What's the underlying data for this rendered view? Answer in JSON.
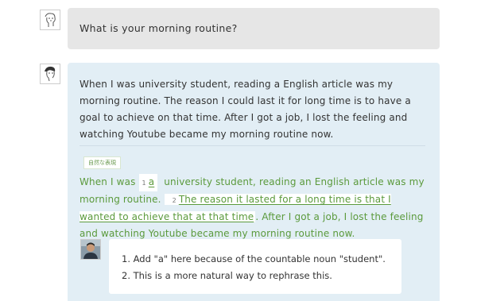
{
  "question": {
    "text": "What is your morning routine?"
  },
  "answer": {
    "text": "When I was university student, reading a English article was my morning routine. The reason I could last it for long time is to have a goal to achieve on that time. After I got a job, I lost the feeling and watching Youtube became my morning routine now."
  },
  "correction": {
    "tag": "自然な表現",
    "part1": "When I was",
    "num1": "1",
    "insert1": "a",
    "part2": "university student, reading an English article was my morning routine.",
    "num2": "2",
    "insert2": "The reason it lasted for a long time is that I wanted to achieve that at that time",
    "part3": ". After I got a job, I lost the feeling and watching Youtube became my morning routine now."
  },
  "notes": [
    "1. Add \"a\" here because of the countable noun \"student\".",
    "2. This is a more natural way to rephrase this."
  ],
  "colors": {
    "question_bg": "#e6e6e6",
    "answer_bg": "#e2eef5",
    "correction_text": "#5b9a3c"
  },
  "icons": {
    "user1": "sketch-avatar-icon",
    "user2": "sketch-avatar-icon",
    "teacher": "teacher-photo-avatar"
  }
}
